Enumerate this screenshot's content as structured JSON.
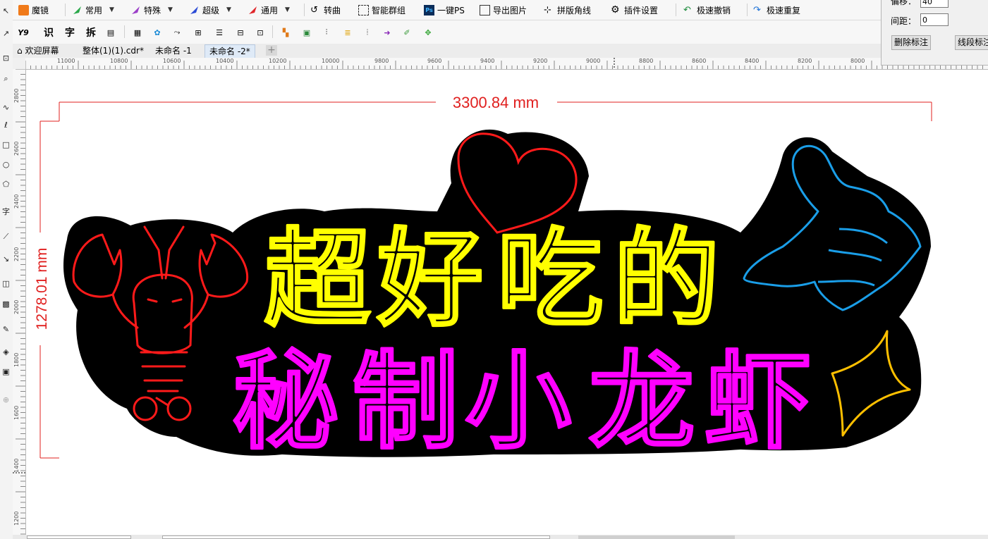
{
  "menu": {
    "items": [
      {
        "label": "魔镜",
        "icon": "mirror-icon"
      },
      {
        "label": "常用",
        "icon": "pen-green-icon",
        "dropdown": true
      },
      {
        "label": "特殊",
        "icon": "pen-purple-icon",
        "dropdown": true
      },
      {
        "label": "超级",
        "icon": "pen-blue-icon",
        "dropdown": true
      },
      {
        "label": "通用",
        "icon": "pen-red-icon",
        "dropdown": true
      },
      {
        "label": "转曲",
        "icon": "curve-icon"
      },
      {
        "label": "智能群组",
        "icon": "group-icon"
      },
      {
        "label": "一键PS",
        "icon": "ps-icon"
      },
      {
        "label": "导出图片",
        "icon": "image-icon"
      },
      {
        "label": "拼版角线",
        "icon": "cropmark-icon"
      },
      {
        "label": "插件设置",
        "icon": "gear-icon"
      },
      {
        "label": "极速撤销",
        "icon": "undo-icon"
      },
      {
        "label": "极速重复",
        "icon": "redo-icon"
      }
    ]
  },
  "toolbar2": {
    "text_icons": [
      "Y9",
      "识",
      "字",
      "拆"
    ]
  },
  "tabs": [
    {
      "label": "欢迎屏幕"
    },
    {
      "label": "整体(1)(1).cdr*"
    },
    {
      "label": "未命名 -1"
    },
    {
      "label": "未命名 -2*",
      "active": true
    }
  ],
  "ruler": {
    "h_labels": [
      "11000",
      "10800",
      "10600",
      "10400",
      "10200",
      "10000",
      "9800",
      "9600",
      "9400",
      "9200",
      "9000",
      "8800",
      "8600",
      "8400",
      "8200",
      "8000"
    ],
    "v_labels": [
      "2800",
      "2600",
      "2400",
      "2200",
      "2000",
      "1800",
      "1600",
      "1400",
      "1200"
    ]
  },
  "docker": {
    "offset_label": "偏移：",
    "offset_value": "40",
    "spacing_label": "间距：",
    "spacing_value": "0",
    "delete_button": "删除标注",
    "segment_button": "线段标注"
  },
  "design": {
    "width_dim": "3300.84 mm",
    "height_dim": "1278.01 mm",
    "line1": [
      "超",
      "好",
      "吃",
      "的"
    ],
    "line2": [
      "秘",
      "制",
      "小",
      "龙",
      "虾"
    ],
    "colors": {
      "line1": "#ffff00",
      "line2": "#ff00ff",
      "lobster": "#ff0000",
      "heart": "#ff0000",
      "hand": "#1a9ee8",
      "sparkle": "#ffc000",
      "dim": "#e0201f"
    }
  }
}
